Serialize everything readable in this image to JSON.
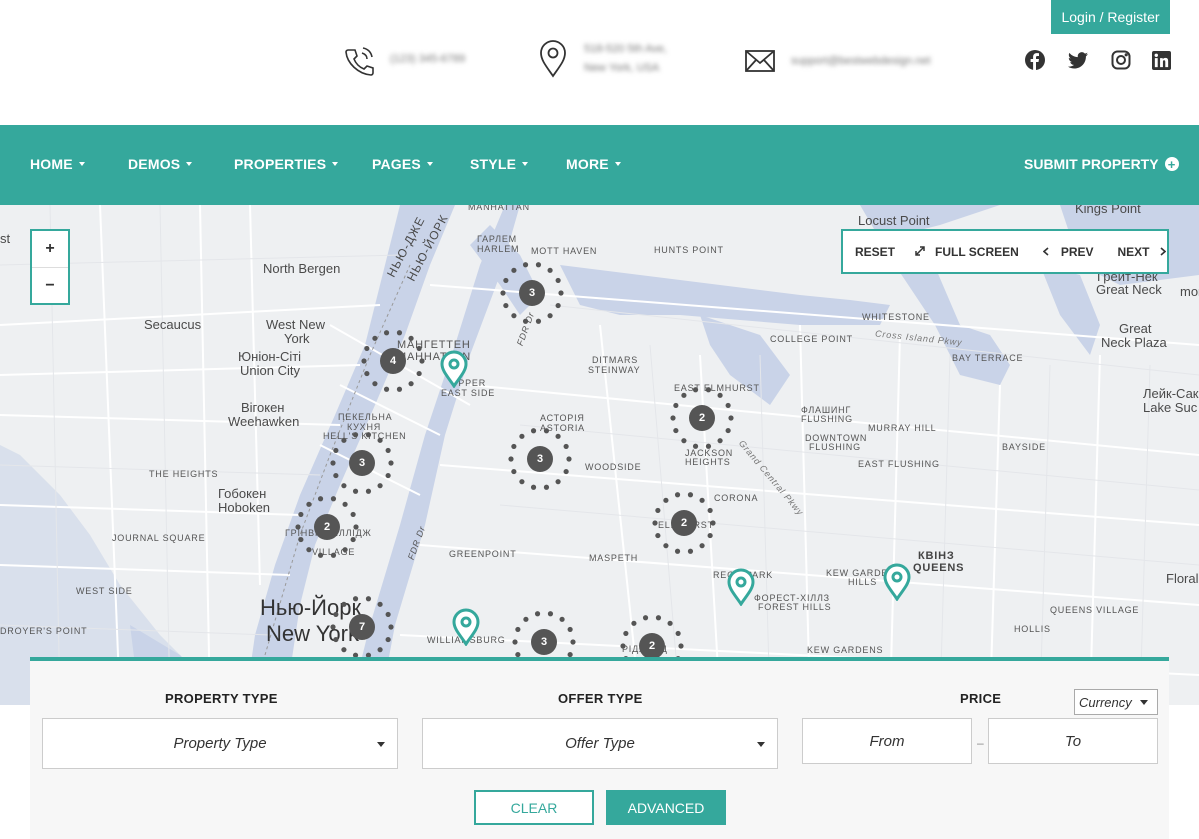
{
  "header": {
    "login_label": "Login / Register",
    "phone": "(123) 345-6789",
    "address_line1": "518-520 5th Ave,",
    "address_line2": "New York, USA",
    "email": "support@bestwebdesign.net",
    "social_icons": [
      "facebook-icon",
      "twitter-icon",
      "instagram-icon",
      "linkedin-icon"
    ]
  },
  "nav": {
    "items": [
      {
        "label": "HOME"
      },
      {
        "label": "DEMOS"
      },
      {
        "label": "PROPERTIES"
      },
      {
        "label": "PAGES"
      },
      {
        "label": "STYLE"
      },
      {
        "label": "MORE"
      }
    ],
    "submit_label": "SUBMIT PROPERTY"
  },
  "map": {
    "zoom_in": "+",
    "zoom_out": "−",
    "controls": {
      "reset": "RESET",
      "fullscreen": "FULL SCREEN",
      "prev": "PREV",
      "next": "NEXT"
    },
    "clusters": [
      {
        "count": "3"
      },
      {
        "count": "4"
      },
      {
        "count": "3"
      },
      {
        "count": "3"
      },
      {
        "count": "2"
      },
      {
        "count": "2"
      },
      {
        "count": "2"
      },
      {
        "count": "7"
      },
      {
        "count": "3"
      },
      {
        "count": "2"
      }
    ],
    "labels": {
      "manhattan": "MANHATTAN",
      "harlem_ua": "ГАРЛЕМ",
      "harlem": "HARLEM",
      "mott_haven": "MOTT HAVEN",
      "hunts_point": "HUNTS POINT",
      "locust_point": "Locust Point",
      "kings_point": "Kings Point",
      "great_neck_ua": "Грейт-Нек",
      "great_neck": "Great Neck",
      "great_neck_plaza_1": "Great",
      "great_neck_plaza_2": "Neck Plaza",
      "lake_success_ua": "Лейк-Сак",
      "lake_success": "Lake Suc",
      "north_bergen": "North Bergen",
      "secaucus": "Secaucus",
      "west_new_york_1": "West New",
      "west_new_york_2": "York",
      "union_city_ua": "Юніон-Сіті",
      "union_city": "Union City",
      "manhattan_ua_1": "МАНГЕТТЕН",
      "manhattan_ua_2": "МАНHATTAN",
      "upper_east_1": "UPPER",
      "upper_east_2": "EAST SIDE",
      "ditmars_1": "DITMARS",
      "ditmars_2": "STEINWAY",
      "whitestone": "WHITESTONE",
      "college_point": "COLLEGE POINT",
      "cross_island": "Cross Island Pkwy",
      "bay_terrace": "BAY TERRACE",
      "east_elmhurst": "EAST ELMHURST",
      "flushing_ua": "ФЛАШИНГ",
      "flushing": "FLUSHING",
      "murray_hill": "MURRAY HILL",
      "downtown_flushing_1": "DOWNTOWN",
      "downtown_flushing_2": "FLUSHING",
      "bayside": "BAYSIDE",
      "east_flushing": "EAST FLUSHING",
      "weehawken_ua": "Вігокен",
      "weehawken": "Weehawken",
      "hells_kitchen_ua_1": "ПЕКЕЛЬНА",
      "hells_kitchen_ua_2": "КУХНЯ",
      "hells_kitchen": "HELL'S KITCHEN",
      "astoria_ua": "АСТОРІЯ",
      "astoria": "ASTORIA",
      "jackson_heights_1": "JACKSON",
      "jackson_heights_2": "HEIGHTS",
      "grand_central": "Grand Central Pkwy",
      "the_heights": "THE HEIGHTS",
      "hoboken_ua": "Гобокен",
      "hoboken": "Hoboken",
      "woodside": "WOODSIDE",
      "corona": "CORONA",
      "journal_square": "JOURNAL SQUARE",
      "greenwich_ua": "ГРІНВІЧ-ВІЛЛІДЖ",
      "greenwich": "VILLAGE",
      "elmhurst": "ELMHURST",
      "greenpoint": "GREENPOINT",
      "maspeth": "MASPETH",
      "rego_park": "REGO PARK",
      "forest_hills_ua": "ФОРЕСТ-ХІЛЛЗ",
      "forest_hills": "FOREST HILLS",
      "kew_gardens_hills_1": "KEW GARDENS",
      "kew_gardens_hills_2": "HILLS",
      "queens_ua": "КВІНЗ",
      "queens": "QUEENS",
      "floral": "Floral",
      "west_side": "WEST SIDE",
      "new_york_ua": "Нью-Йорк",
      "new_york": "New York",
      "williamsburg": "WILLIAMSBURG",
      "ridgewood": "РІДЖВУД",
      "queens_village": "QUEENS VILLAGE",
      "hollis": "HOLLIS",
      "kew_gardens": "KEW GARDENS",
      "droyers_point": "DROYER'S POINT",
      "hudson_river_ua": "НЬЮ-ДЖЕ",
      "hudson_river_ua_2": "НЬЮ-ЙОРК",
      "fdr": "FDR Dr",
      "mont": "mont",
      "st": "st"
    }
  },
  "search": {
    "property_type_label": "PROPERTY TYPE",
    "property_type_value": "Property Type",
    "offer_type_label": "OFFER TYPE",
    "offer_type_value": "Offer Type",
    "price_label": "PRICE",
    "currency_value": "Currency",
    "from_placeholder": "From",
    "to_placeholder": "To",
    "dash": "–",
    "clear_label": "CLEAR",
    "advanced_label": "ADVANCED"
  },
  "colors": {
    "accent": "#35a89c",
    "cluster": "#555555",
    "map_bg": "#eef0f2",
    "water": "#c9d3e8"
  }
}
